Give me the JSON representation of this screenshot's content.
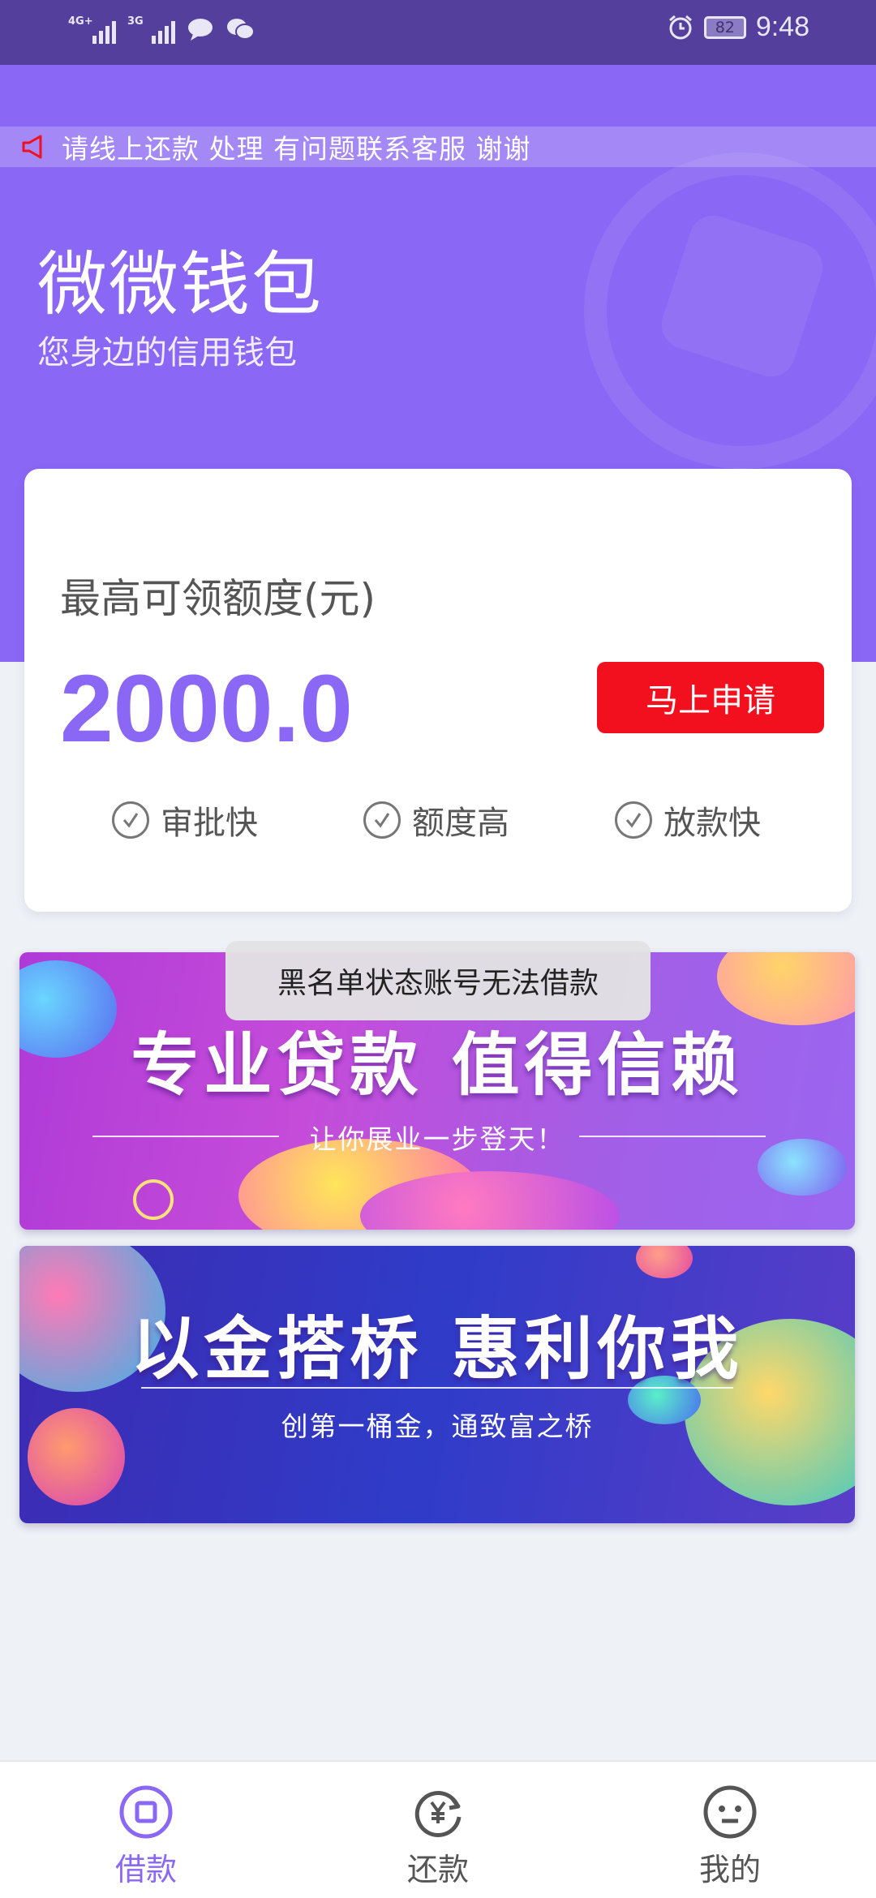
{
  "status_bar": {
    "sim1": "4G+",
    "sim2": "3G",
    "battery": "82",
    "time": "9:48"
  },
  "notice": {
    "text": "请线上还款 处理  有问题联系客服  谢谢"
  },
  "app": {
    "title": "微微钱包",
    "subtitle": "您身边的信用钱包"
  },
  "quota_card": {
    "label": "最高可领额度(元)",
    "amount": "2000.0",
    "apply_label": "马上申请",
    "features": [
      "审批快",
      "额度高",
      "放款快"
    ]
  },
  "banners": [
    {
      "title": "专业贷款 值得信赖",
      "subtitle": "让你展业一步登天！"
    },
    {
      "title": "以金搭桥 惠利你我",
      "subtitle": "创第一桶金，通致富之桥"
    }
  ],
  "toast": {
    "text": "黑名单状态账号无法借款"
  },
  "bottom_nav": {
    "items": [
      {
        "label": "借款",
        "icon": "loan-icon",
        "active": true
      },
      {
        "label": "还款",
        "icon": "repay-icon",
        "active": false
      },
      {
        "label": "我的",
        "icon": "profile-icon",
        "active": false
      }
    ]
  },
  "colors": {
    "accent": "#8a67f4",
    "status_bar": "#54409c",
    "apply_button": "#f3101e",
    "nav_active": "#8a67f4",
    "nav_inactive": "#555555"
  }
}
